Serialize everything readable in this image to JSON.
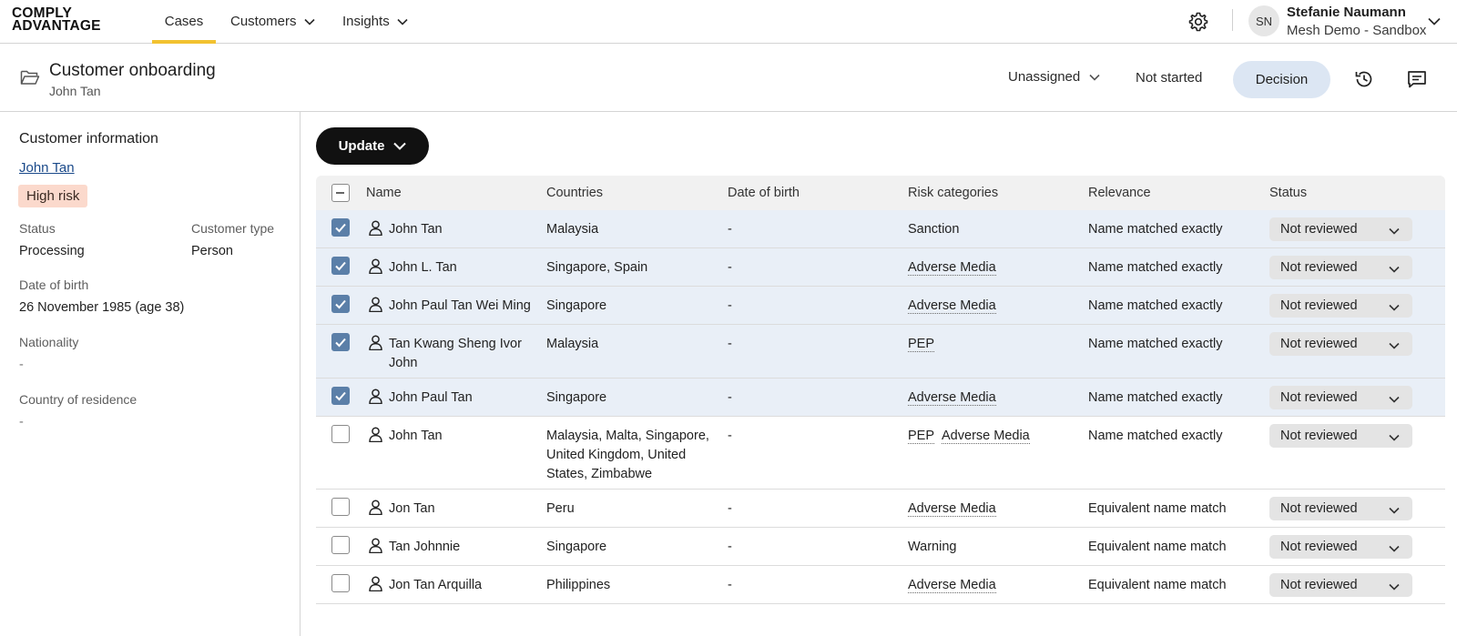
{
  "brand": {
    "line1": "COMPLY",
    "line2": "ADVANTAGE"
  },
  "nav": {
    "cases": "Cases",
    "customers": "Customers",
    "insights": "Insights"
  },
  "user": {
    "initials": "SN",
    "name": "Stefanie Naumann",
    "org": "Mesh Demo - Sandbox"
  },
  "case": {
    "title": "Customer onboarding",
    "subtitle": "John Tan",
    "assignee": "Unassigned",
    "status": "Not started",
    "decision_label": "Decision"
  },
  "sidebar": {
    "title": "Customer information",
    "customer_link": "John Tan",
    "risk_badge": "High risk",
    "status_label": "Status",
    "status_value": "Processing",
    "type_label": "Customer type",
    "type_value": "Person",
    "dob_label": "Date of birth",
    "dob_value": "26 November 1985 (age 38)",
    "nationality_label": "Nationality",
    "nationality_value": "-",
    "residence_label": "Country of residence",
    "residence_value": "-"
  },
  "toolbar": {
    "update_label": "Update"
  },
  "table": {
    "headers": {
      "name": "Name",
      "countries": "Countries",
      "dob": "Date of birth",
      "risk": "Risk categories",
      "relevance": "Relevance",
      "status": "Status"
    },
    "rows": [
      {
        "checked": true,
        "name": "John Tan",
        "countries": "Malaysia",
        "dob": "-",
        "risk": "Sanction",
        "risk2": "",
        "relevance": "Name matched exactly",
        "status": "Not reviewed"
      },
      {
        "checked": true,
        "name": "John L. Tan",
        "countries": "Singapore, Spain",
        "dob": "-",
        "risk": "Adverse Media",
        "risk2": "",
        "relevance": "Name matched exactly",
        "status": "Not reviewed"
      },
      {
        "checked": true,
        "name": "John Paul Tan Wei Ming",
        "countries": "Singapore",
        "dob": "-",
        "risk": "Adverse Media",
        "risk2": "",
        "relevance": "Name matched exactly",
        "status": "Not reviewed"
      },
      {
        "checked": true,
        "name": "Tan Kwang Sheng Ivor John",
        "countries": "Malaysia",
        "dob": "-",
        "risk": "PEP",
        "risk2": "",
        "relevance": "Name matched exactly",
        "status": "Not reviewed"
      },
      {
        "checked": true,
        "name": "John Paul Tan",
        "countries": "Singapore",
        "dob": "-",
        "risk": "Adverse Media",
        "risk2": "",
        "relevance": "Name matched exactly",
        "status": "Not reviewed"
      },
      {
        "checked": false,
        "name": "John Tan",
        "countries": "Malaysia, Malta, Singapore, United Kingdom, United States, Zimbabwe",
        "dob": "-",
        "risk": "PEP",
        "risk2": "Adverse Media",
        "relevance": "Name matched exactly",
        "status": "Not reviewed"
      },
      {
        "checked": false,
        "name": "Jon Tan",
        "countries": "Peru",
        "dob": "-",
        "risk": "Adverse Media",
        "risk2": "",
        "relevance": "Equivalent name match",
        "status": "Not reviewed"
      },
      {
        "checked": false,
        "name": "Tan Johnnie",
        "countries": "Singapore",
        "dob": "-",
        "risk": "Warning",
        "risk2": "",
        "relevance": "Equivalent name match",
        "status": "Not reviewed"
      },
      {
        "checked": false,
        "name": "Jon Tan Arquilla",
        "countries": "Philippines",
        "dob": "-",
        "risk": "Adverse Media",
        "risk2": "",
        "relevance": "Equivalent name match",
        "status": "Not reviewed"
      }
    ]
  },
  "colors": {
    "accent": "#f2c230",
    "selected_row": "#e9eff7",
    "checkbox_checked": "#5b7fa8",
    "risk_badge_bg": "#fbd9cc",
    "decision_bg": "#dce6f3"
  },
  "icons": [
    "settings-gear-icon",
    "folder-icon",
    "history-icon",
    "comment-icon",
    "person-icon",
    "chevron-down-icon",
    "checkmark-icon"
  ]
}
